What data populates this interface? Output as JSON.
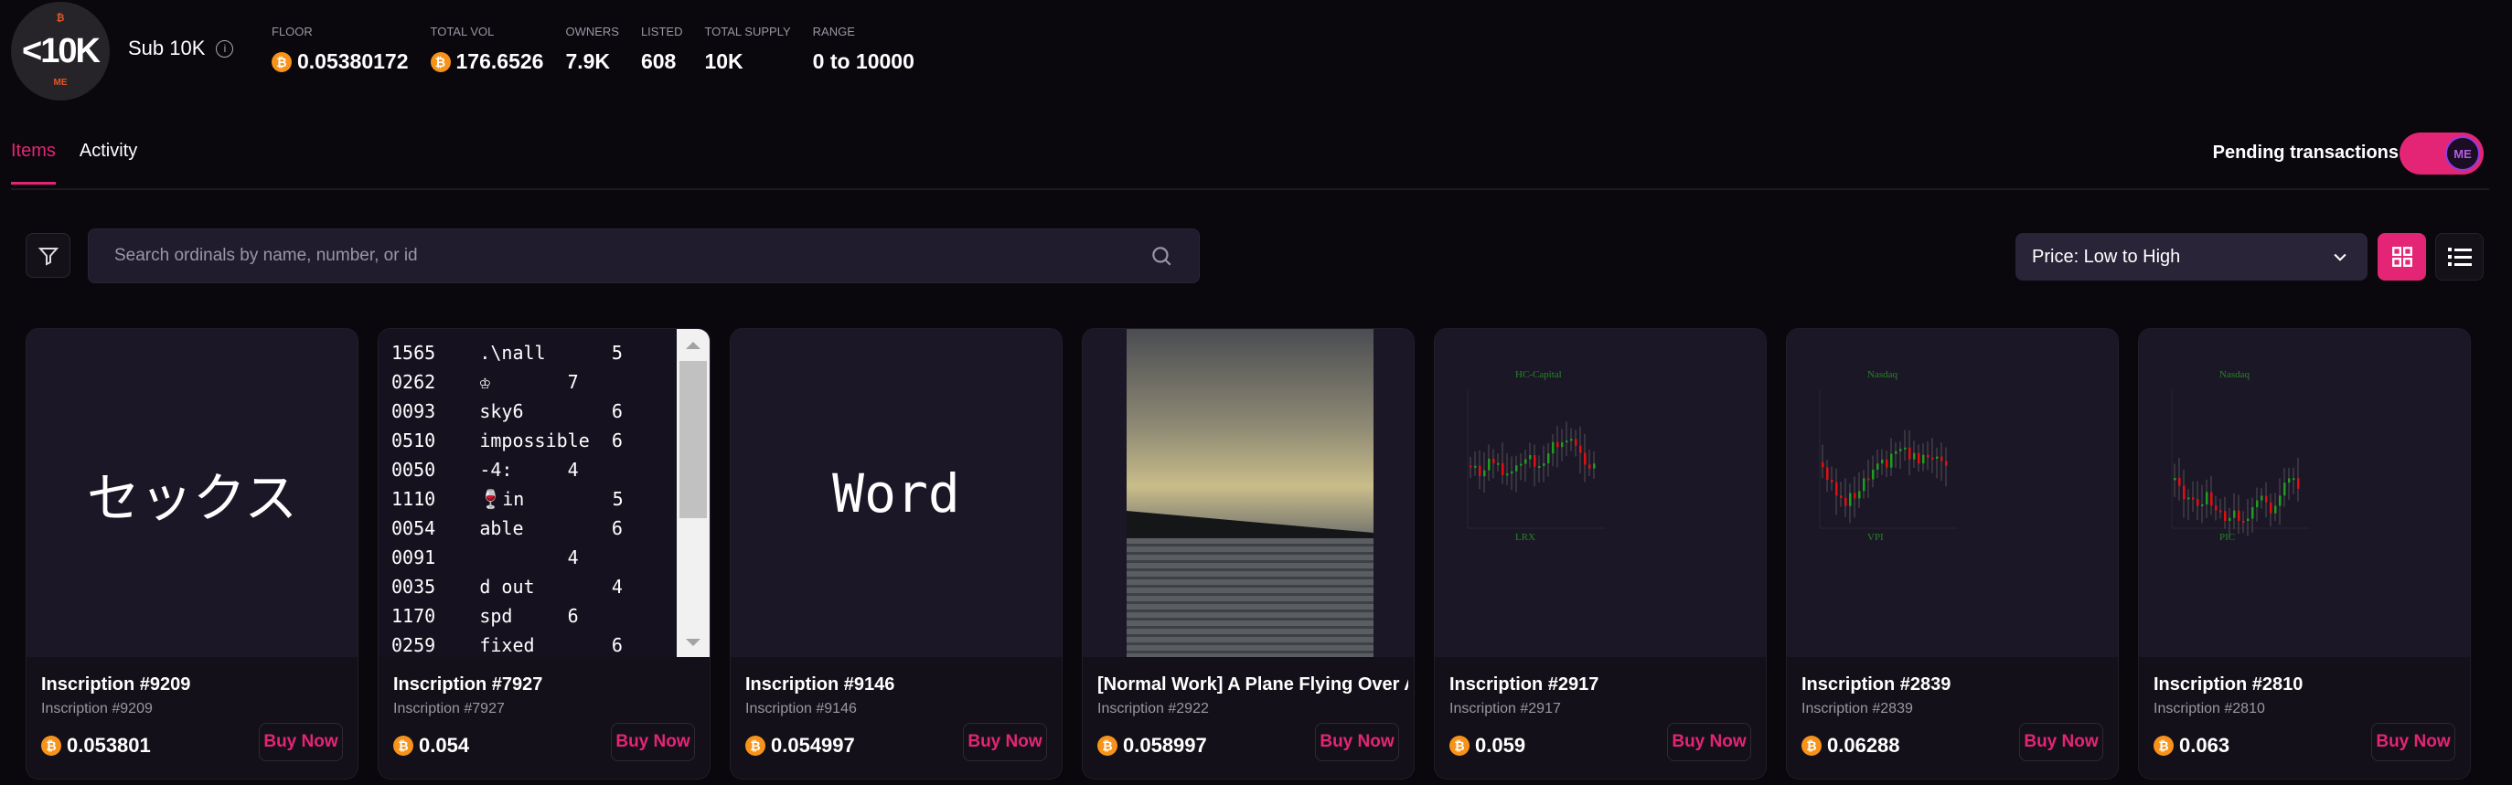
{
  "collection": {
    "logo_text": "<10K",
    "logo_marks": [
      "₿",
      "ME"
    ],
    "name": "Sub 10K",
    "stats": [
      {
        "label": "FLOOR",
        "value": "0.05380172",
        "btc": true
      },
      {
        "label": "TOTAL VOL",
        "value": "176.6526",
        "btc": true
      },
      {
        "label": "OWNERS",
        "value": "7.9K"
      },
      {
        "label": "LISTED",
        "value": "608"
      },
      {
        "label": "TOTAL SUPPLY",
        "value": "10K"
      },
      {
        "label": "RANGE",
        "value": "0 to 10000"
      }
    ]
  },
  "tabs": [
    {
      "label": "Items",
      "active": true
    },
    {
      "label": "Activity"
    }
  ],
  "pending": {
    "label": "Pending transactions",
    "on": true,
    "knob": "ME"
  },
  "search": {
    "placeholder": "Search ordinals by name, number, or id"
  },
  "sort": {
    "selected": "Price: Low to High"
  },
  "view": {
    "active": "grid"
  },
  "colors": {
    "accent": "#e42575",
    "btc": "#f7931a",
    "bg": "#0a070d",
    "card": "#141019"
  },
  "cards": [
    {
      "title": "Inscription #9209",
      "sub": "Inscription #9209",
      "price": "0.053801",
      "buy": "Buy Now",
      "media_text": "セックス"
    },
    {
      "title": "Inscription #7927",
      "sub": "Inscription #7927",
      "price": "0.054",
      "buy": "Buy Now",
      "lines": [
        "1565    .\\nall      5",
        "0262    ♔       7",
        "0093    sky6        6",
        "0510    impossible  6",
        "0050    -4:     4",
        "1110    🍷in        5",
        "0054    able        6",
        "0091            4",
        "0035    d out       4",
        "1170    spd     6",
        "0259    fixed       6"
      ]
    },
    {
      "title": "Inscription #9146",
      "sub": "Inscription #9146",
      "price": "0.054997",
      "buy": "Buy Now",
      "media_text": "Word"
    },
    {
      "title": "[Normal Work] A Plane Flying Over A",
      "sub": "Inscription #2922",
      "price": "0.058997",
      "buy": "Buy Now"
    },
    {
      "title": "Inscription #2917",
      "sub": "Inscription #2917",
      "price": "0.059",
      "buy": "Buy Now",
      "chart_top": "HC-Capital",
      "chart_bottom": "LRX"
    },
    {
      "title": "Inscription #2839",
      "sub": "Inscription #2839",
      "price": "0.06288",
      "buy": "Buy Now",
      "chart_top": "Nasdaq",
      "chart_bottom": "VPI"
    },
    {
      "title": "Inscription #2810",
      "sub": "Inscription #2810",
      "price": "0.063",
      "buy": "Buy Now",
      "chart_top": "Nasdaq",
      "chart_bottom": "PIC"
    }
  ]
}
